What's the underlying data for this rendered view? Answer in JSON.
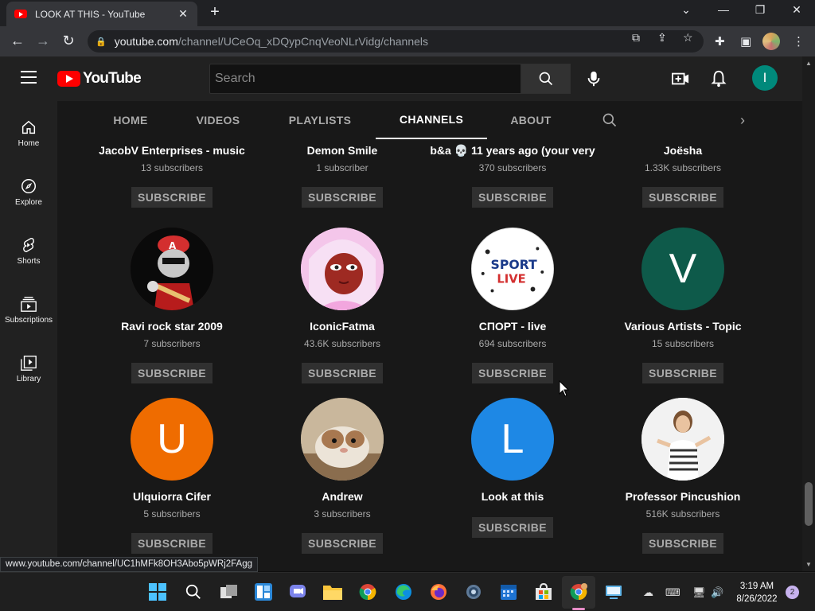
{
  "browser": {
    "tab_title": "LOOK AT THIS - YouTube",
    "url_host": "youtube.com",
    "url_path": "/channel/UCeOq_xDQypCnqVeoNLrVidg/channels",
    "status_url": "www.youtube.com/channel/UC1hMFk8OH3Abo5pWRj2FAgg"
  },
  "youtube": {
    "logo_text": "YouTube",
    "search_placeholder": "Search",
    "avatar_letter": "I"
  },
  "guide": [
    {
      "label": "Home",
      "icon": "home-icon"
    },
    {
      "label": "Explore",
      "icon": "compass-icon"
    },
    {
      "label": "Shorts",
      "icon": "shorts-icon"
    },
    {
      "label": "Subscriptions",
      "icon": "subscriptions-icon"
    },
    {
      "label": "Library",
      "icon": "library-icon"
    }
  ],
  "channel_tabs": [
    {
      "label": "HOME"
    },
    {
      "label": "VIDEOS"
    },
    {
      "label": "PLAYLISTS"
    },
    {
      "label": "CHANNELS",
      "active": true
    },
    {
      "label": "ABOUT"
    }
  ],
  "channels": [
    {
      "name": "JacobV Enterprises - music",
      "subs": "13 subscribers",
      "button": "SUBSCRIBE"
    },
    {
      "name": "Demon Smile",
      "subs": "1 subscriber",
      "button": "SUBSCRIBE"
    },
    {
      "name": "b&a 💀 11 years ago (your very",
      "subs": "370 subscribers",
      "button": "SUBSCRIBE"
    },
    {
      "name": "Joësha",
      "subs": "1.33K subscribers",
      "button": "SUBSCRIBE"
    },
    {
      "name": "Ravi rock star 2009",
      "subs": "7 subscribers",
      "button": "SUBSCRIBE",
      "avatar": "image"
    },
    {
      "name": "IconicFatma",
      "subs": "43.6K subscribers",
      "button": "SUBSCRIBE",
      "avatar": "image"
    },
    {
      "name": "СПОРТ - live",
      "subs": "694 subscribers",
      "button": "SUBSCRIBE",
      "avatar": "image",
      "avatar_text_1": "SPORT",
      "avatar_text_2": "LIVE"
    },
    {
      "name": "Various Artists - Topic",
      "subs": "15 subscribers",
      "button": "SUBSCRIBE",
      "avatar_letter": "V",
      "color": "#0e5a4a"
    },
    {
      "name": "Ulquiorra Cifer",
      "subs": "5 subscribers",
      "button": "SUBSCRIBE",
      "avatar_letter": "U",
      "color": "#ef6c00"
    },
    {
      "name": "Andrew",
      "subs": "3 subscribers",
      "button": "SUBSCRIBE",
      "avatar": "image"
    },
    {
      "name": "Look at this",
      "subs": "",
      "button": "SUBSCRIBE",
      "avatar_letter": "L",
      "color": "#1e88e5"
    },
    {
      "name": "Professor Pincushion",
      "subs": "516K subscribers",
      "button": "SUBSCRIBE",
      "avatar": "image"
    }
  ],
  "taskbar": {
    "time": "3:19 AM",
    "date": "8/26/2022",
    "notifications": "2"
  }
}
